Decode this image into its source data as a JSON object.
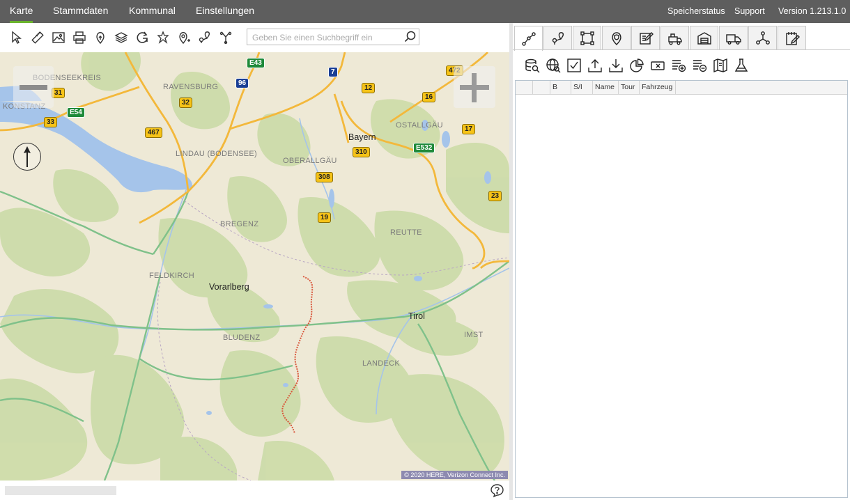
{
  "topnav": {
    "items": [
      "Karte",
      "Stammdaten",
      "Kommunal",
      "Einstellungen"
    ],
    "active": "Karte",
    "right": {
      "storage_status": "Speicherstatus",
      "support": "Support",
      "version": "Version 1.213.1.0"
    }
  },
  "toolbar": {
    "tools": [
      "select-icon",
      "ruler-icon",
      "image-icon",
      "print-icon",
      "pin-icon",
      "layers-icon",
      "refresh-icon",
      "star-pin-icon",
      "pin-add-icon",
      "route-pins-icon",
      "route-split-icon"
    ],
    "search_placeholder": "Geben Sie einen Suchbegriff ein"
  },
  "map": {
    "region_labels": {
      "bodenseekreis": "BODENSEEKREIS",
      "ravensburg": "RAVENSBURG",
      "konstanz": "KONSTANZ",
      "ostallgaeu": "OSTALLGÄU",
      "lindau": "LINDAU (BODENSEE)",
      "oberallgaeu": "OBERALLGÄU",
      "bregenz": "BREGENZ",
      "reutte": "REUTTE",
      "feldkirch": "FELDKIRCH",
      "bludenz": "BLUDENZ",
      "landeck": "LANDECK",
      "imst": "IMST"
    },
    "state_labels": {
      "bayern": "Bayern",
      "vorarlberg": "Vorarlberg",
      "tirol": "Tirol"
    },
    "road_shields": {
      "r472": "472",
      "r12": "12",
      "r16": "16",
      "r17": "17",
      "r31": "31",
      "r32": "32",
      "r33": "33",
      "r467": "467",
      "r310": "310",
      "r308": "308",
      "r19": "19",
      "r23": "23",
      "e43": "E43",
      "e54": "E54",
      "e532": "E532",
      "a7": "7",
      "a96": "96"
    },
    "copyright": "© 2020 HERE, Verizon Connect Inc.",
    "colors": {
      "water": "#a5c4ea",
      "land": "#eee9d6",
      "forest": "#c8d9a4",
      "motorway": "#f3b83b",
      "route": "#d9573c"
    }
  },
  "panel": {
    "tabs": [
      "route-icon",
      "map-pin-route-icon",
      "area-select-icon",
      "location-shield-icon",
      "edit-form-icon",
      "vehicle-sweeper-icon",
      "depot-icon",
      "truck-icon",
      "network-icon",
      "notepad-icon"
    ],
    "actions": [
      "db-search-icon",
      "globe-search-icon",
      "checkbox-icon",
      "upload-icon",
      "download-icon",
      "pie-chart-icon",
      "clear-icon",
      "list-add-icon",
      "list-remove-icon",
      "map-book-icon",
      "flask-icon"
    ],
    "grid_columns": [
      "",
      "",
      "B",
      "S/I",
      "Name",
      "Tour",
      "Fahrzeug"
    ]
  }
}
